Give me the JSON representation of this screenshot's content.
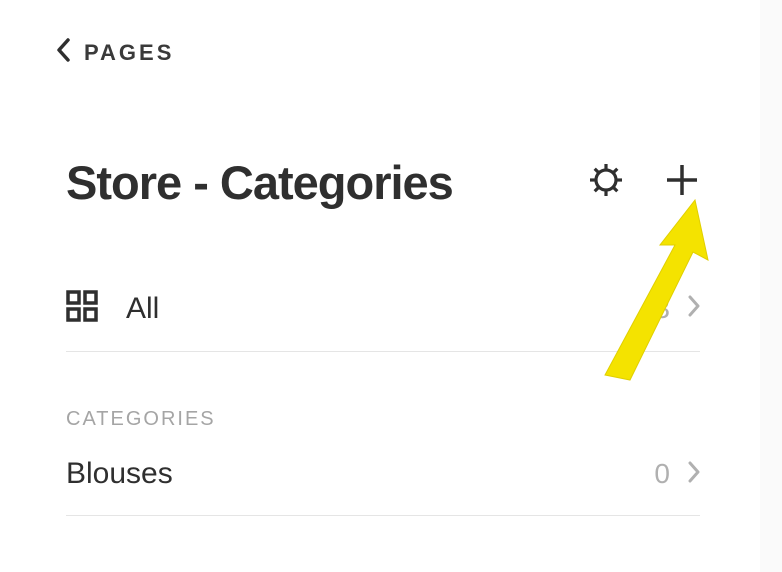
{
  "nav": {
    "back_label": "PAGES"
  },
  "header": {
    "title": "Store - Categories"
  },
  "all_row": {
    "label": "All",
    "count": "3"
  },
  "section": {
    "label": "CATEGORIES"
  },
  "categories": [
    {
      "label": "Blouses",
      "count": "0"
    }
  ],
  "colors": {
    "arrow": "#f4e300"
  }
}
